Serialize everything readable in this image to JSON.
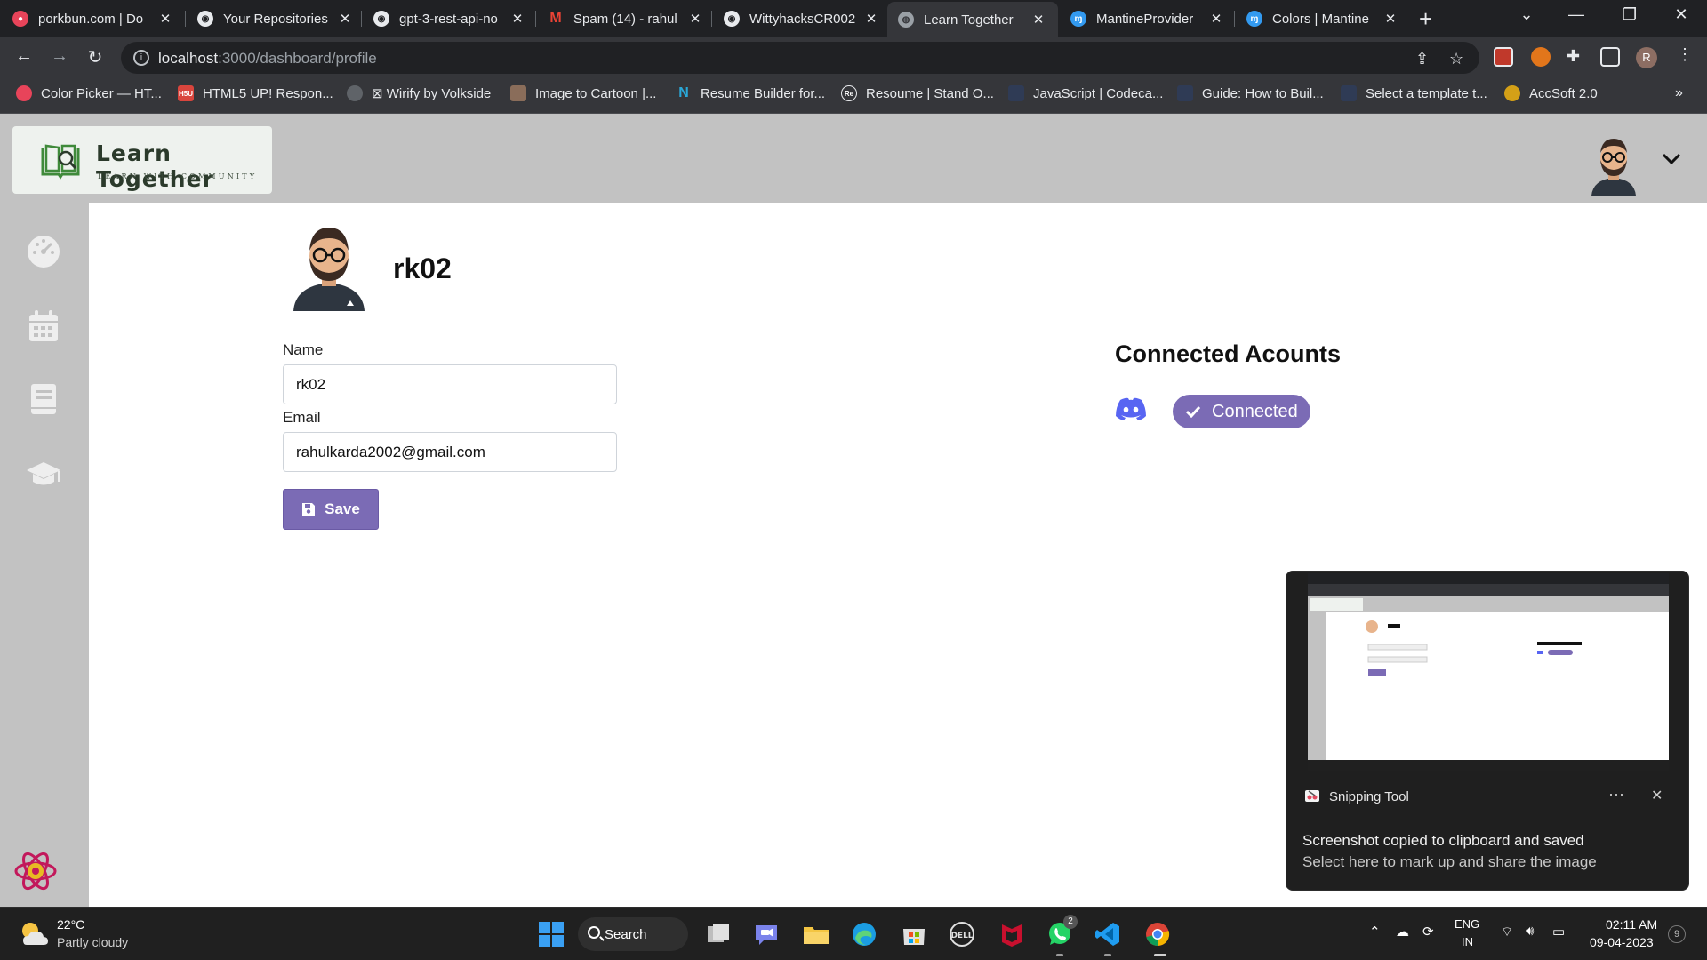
{
  "browser": {
    "tabs": [
      {
        "title": "porkbun.com | Do",
        "icon_color": "#e8445a"
      },
      {
        "title": "Your Repositories",
        "icon_color": "#e8eaed"
      },
      {
        "title": "gpt-3-rest-api-no",
        "icon_color": "#e8eaed"
      },
      {
        "title": "Spam (14) - rahul",
        "icon_color": "#ea4335"
      },
      {
        "title": "WittyhacksCR002",
        "icon_color": "#e8eaed"
      },
      {
        "title": "Learn Together",
        "icon_color": "#9aa0a6"
      },
      {
        "title": "MantineProvider",
        "icon_color": "#339af0"
      },
      {
        "title": "Colors | Mantine",
        "icon_color": "#339af0"
      }
    ],
    "active_tab_index": 5,
    "url_host": "localhost",
    "url_path": ":3000/dashboard/profile",
    "profile_initial": "R",
    "bookmarks": [
      {
        "label": "Color Picker — HT...",
        "icon_color": "#e8445a",
        "icon_text": ""
      },
      {
        "label": "HTML5 UP! Respon...",
        "icon_color": "#d9453d",
        "icon_text": "H5U"
      },
      {
        "label": "⊠ Wirify by Volkside",
        "icon_color": "#5f6368",
        "icon_text": ""
      },
      {
        "label": "Image to Cartoon |...",
        "icon_color": "#8a6d5a",
        "icon_text": ""
      },
      {
        "label": "Resume Builder for...",
        "icon_color": "#2aa8d8",
        "icon_text": "N"
      },
      {
        "label": "Resoume | Stand O...",
        "icon_color": "#35363a",
        "icon_text": "Re"
      },
      {
        "label": "JavaScript | Codeca...",
        "icon_color": "#2f3b55",
        "icon_text": ""
      },
      {
        "label": "Guide: How to Buil...",
        "icon_color": "#2f3b55",
        "icon_text": ""
      },
      {
        "label": "Select a template t...",
        "icon_color": "#2f3b55",
        "icon_text": ""
      },
      {
        "label": "AccSoft 2.0",
        "icon_color": "#d4a017",
        "icon_text": ""
      }
    ]
  },
  "app": {
    "logo_title": "Learn Together",
    "logo_subtitle": "LEARN WITH COMMUNITY",
    "sidebar": [
      {
        "icon": "dashboard-gauge-icon"
      },
      {
        "icon": "calendar-icon"
      },
      {
        "icon": "book-icon"
      },
      {
        "icon": "graduation-cap-icon"
      }
    ]
  },
  "profile": {
    "username": "rk02",
    "name_label": "Name",
    "name_value": "rk02",
    "email_label": "Email",
    "email_value": "rahulkarda2002@gmail.com",
    "save_label": "Save"
  },
  "connected": {
    "title": "Connected Acounts",
    "discord_status": "Connected"
  },
  "toast": {
    "app_name": "Snipping Tool",
    "dots": "···",
    "close": "✕",
    "line1": "Screenshot copied to clipboard and saved",
    "line2": "Select here to mark up and share the image"
  },
  "taskbar": {
    "temperature": "22°C",
    "weather": "Partly cloudy",
    "search_label": "Search",
    "whatsapp_badge": "2",
    "lang_line1": "ENG",
    "lang_line2": "IN",
    "time": "02:11 AM",
    "date": "09-04-2023",
    "notifications": "9"
  },
  "colors": {
    "accent": "#7b6bb5",
    "sidebar_bg": "#c2c2c2",
    "discord": "#5865f2"
  }
}
